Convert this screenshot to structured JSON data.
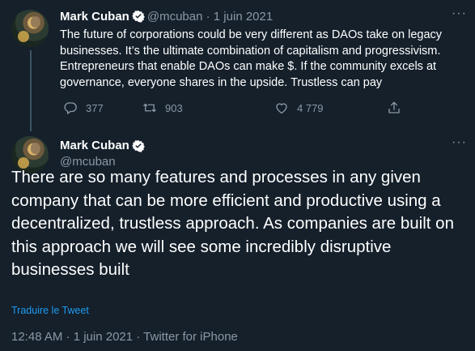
{
  "tweet1": {
    "author_name": "Mark Cuban",
    "handle": "@mcuban",
    "separator": "·",
    "date": "1 juin 2021",
    "text": "The future of corporations could be very different as DAOs take on legacy businesses. It’s the ultimate combination of capitalism and progressivism. Entrepreneurs that enable DAOs can make $. If the community excels at governance, everyone shares in the upside. Trustless can pay",
    "replies": "377",
    "retweets": "903",
    "likes": "4 779",
    "more": "···"
  },
  "tweet2": {
    "author_name": "Mark Cuban",
    "handle": "@mcuban",
    "more": "···",
    "text": "There are so many features and processes in any given company that can be more efficient and productive using a decentralized, trustless approach. As companies are built on this approach we will see some incredibly disruptive businesses built",
    "translate_label": "Traduire le Tweet",
    "timestamp": "12:48 AM · 1 juin 2021 · Twitter for iPhone"
  },
  "colors": {
    "background": "#15202b",
    "text": "#ffffff",
    "secondary": "#8b98a5",
    "accent": "#1d9bf0"
  },
  "icons": [
    "verified-badge-icon",
    "reply-icon",
    "retweet-icon",
    "like-icon",
    "share-icon",
    "more-icon"
  ]
}
